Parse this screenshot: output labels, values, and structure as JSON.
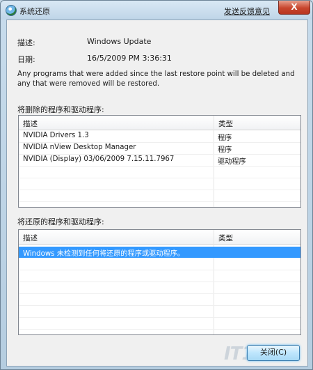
{
  "window": {
    "title": "系统还原",
    "feedback_link": "发送反馈意见",
    "close_symbol": "X"
  },
  "info": {
    "description_label": "描述:",
    "description_value": "Windows Update",
    "date_label": "日期:",
    "date_value": "16/5/2009 PM 3:36:31",
    "notice": "Any programs that were added since the last restore point will be deleted and any that were removed will be restored."
  },
  "deleted_section": {
    "title": "将删除的程序和驱动程序:",
    "columns": [
      "描述",
      "类型"
    ],
    "rows": [
      {
        "description": "NVIDIA Drivers 1.3",
        "type": "程序"
      },
      {
        "description": "NVIDIA nView Desktop Manager",
        "type": "程序"
      },
      {
        "description": "NVIDIA (Display) 03/06/2009 7.15.11.7967",
        "type": "驱动程序"
      }
    ]
  },
  "restored_section": {
    "title": "将还原的程序和驱动程序:",
    "columns": [
      "描述",
      "类型"
    ],
    "rows": [
      {
        "description": "Windows 未检测到任何将还原的程序或驱动程序。",
        "type": ""
      }
    ]
  },
  "buttons": {
    "close_label": "关闭(C)"
  },
  "watermark": "IT168"
}
